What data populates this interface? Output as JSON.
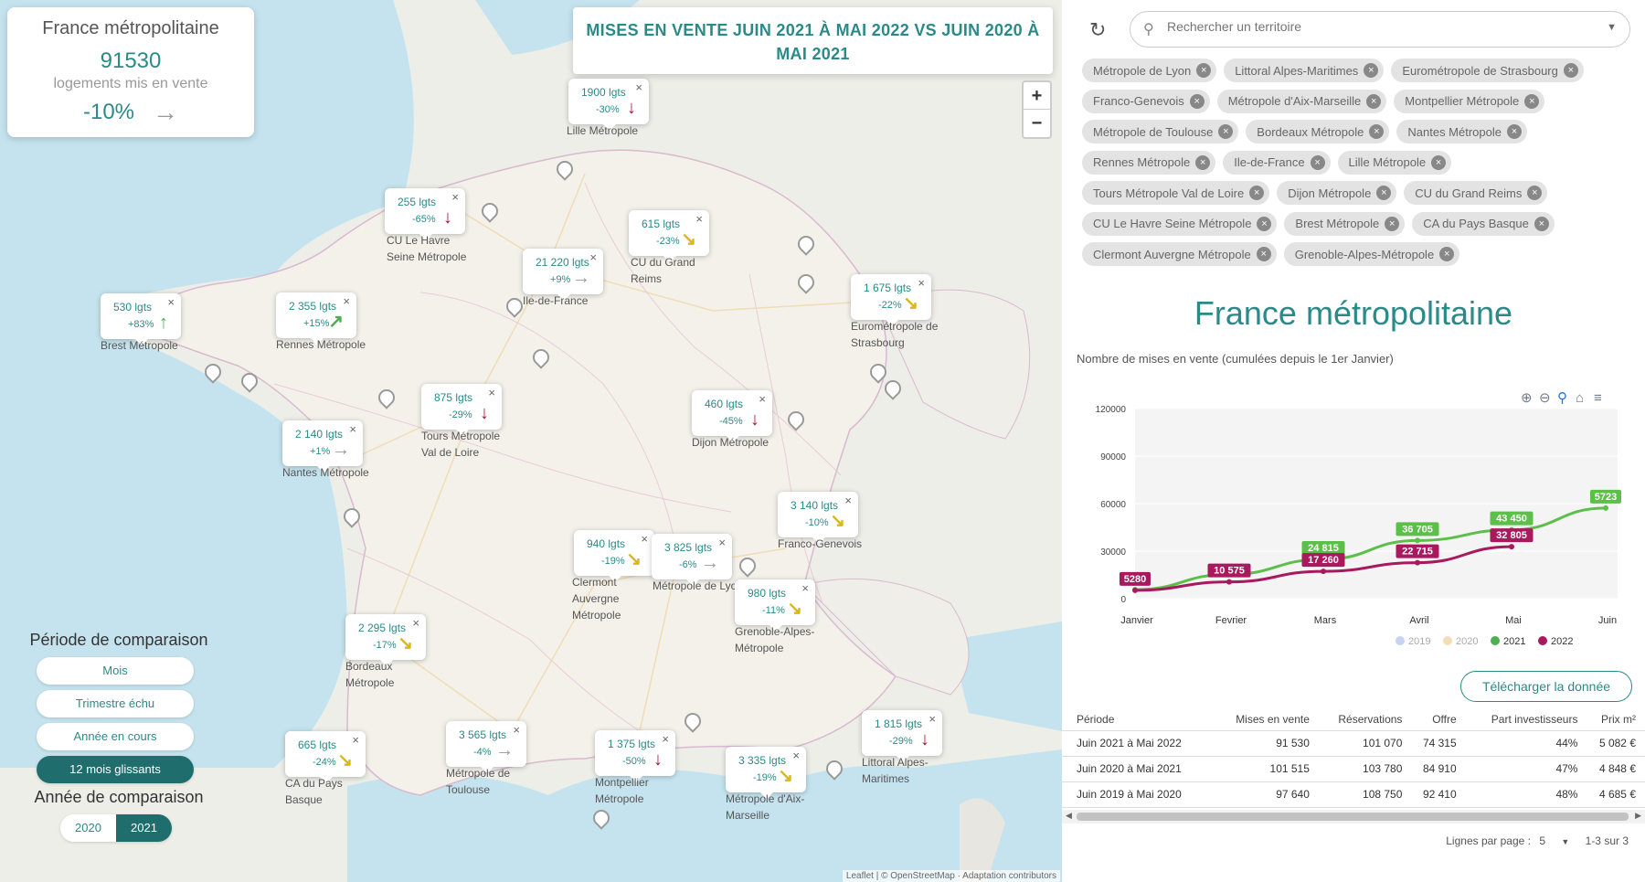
{
  "summary": {
    "title": "France métropolitaine",
    "count": "91530",
    "subtitle": "logements mis en vente",
    "change": "-10%",
    "arrow": "→"
  },
  "map_title": "MISES EN VENTE JUIN 2021 À MAI 2022 VS JUIN 2020 À MAI 2021",
  "zoom": {
    "in": "+",
    "out": "−"
  },
  "markers": [
    {
      "value": "1900 lgts",
      "change": "-30%",
      "trend": "down",
      "label": "Lille Métropole"
    },
    {
      "value": "255 lgts",
      "change": "-65%",
      "trend": "down",
      "label": "CU Le Havre Seine Métropole"
    },
    {
      "value": "615 lgts",
      "change": "-23%",
      "trend": "down-right",
      "label": "CU du Grand Reims"
    },
    {
      "value": "21 220 lgts",
      "change": "+9%",
      "trend": "flat",
      "label": "Ile-de-France"
    },
    {
      "value": "530 lgts",
      "change": "+83%",
      "trend": "up",
      "label": "Brest Métropole"
    },
    {
      "value": "2 355 lgts",
      "change": "+15%",
      "trend": "up-right",
      "label": "Rennes Métropole"
    },
    {
      "value": "1 675 lgts",
      "change": "-22%",
      "trend": "down-right",
      "label": "Eurométropole de Strasbourg"
    },
    {
      "value": "875 lgts",
      "change": "-29%",
      "trend": "down",
      "label": "Tours Métropole Val de Loire"
    },
    {
      "value": "460 lgts",
      "change": "-45%",
      "trend": "down",
      "label": "Dijon Métropole"
    },
    {
      "value": "2 140 lgts",
      "change": "+1%",
      "trend": "flat",
      "label": "Nantes Métropole"
    },
    {
      "value": "3 140 lgts",
      "change": "-10%",
      "trend": "down-right",
      "label": "Franco-Genevois"
    },
    {
      "value": "940 lgts",
      "change": "-19%",
      "trend": "down-right",
      "label": "Clermont Auvergne Métropole"
    },
    {
      "value": "3 825 lgts",
      "change": "-6%",
      "trend": "flat",
      "label": "Métropole de Lyon"
    },
    {
      "value": "980 lgts",
      "change": "-11%",
      "trend": "down-right",
      "label": "Grenoble-Alpes-Métropole"
    },
    {
      "value": "2 295 lgts",
      "change": "-17%",
      "trend": "down-right",
      "label": "Bordeaux Métropole"
    },
    {
      "value": "1 815 lgts",
      "change": "-29%",
      "trend": "down",
      "label": "Littoral Alpes-Maritimes"
    },
    {
      "value": "665 lgts",
      "change": "-24%",
      "trend": "down-right",
      "label": "CA du Pays Basque"
    },
    {
      "value": "3 565 lgts",
      "change": "-4%",
      "trend": "flat",
      "label": "Métropole de Toulouse"
    },
    {
      "value": "1 375 lgts",
      "change": "-50%",
      "trend": "down",
      "label": "Montpellier Métropole"
    },
    {
      "value": "3 335 lgts",
      "change": "-19%",
      "trend": "down-right",
      "label": "Métropole d'Aix-Marseille"
    }
  ],
  "trend_colors": {
    "down": "#a8193c",
    "down-right": "#d8b81a",
    "flat": "#999999",
    "up": "#4caf50",
    "up-right": "#4caf50"
  },
  "period": {
    "title": "Période de comparaison",
    "options": [
      "Mois",
      "Trimestre échu",
      "Année en cours",
      "12 mois glissants"
    ],
    "selected": "12 mois glissants"
  },
  "year": {
    "title": "Année de comparaison",
    "options": [
      "2020",
      "2021"
    ],
    "selected": "2021"
  },
  "attribution": "Leaflet | © OpenStreetMap · Adaptation contributors",
  "search": {
    "placeholder": "Rechercher un territoire"
  },
  "chips": [
    "Métropole de Lyon",
    "Littoral Alpes-Maritimes",
    "Eurométropole de Strasbourg",
    "Franco-Genevois",
    "Métropole d'Aix-Marseille",
    "Montpellier Métropole",
    "Métropole de Toulouse",
    "Bordeaux Métropole",
    "Nantes Métropole",
    "Rennes Métropole",
    "Ile-de-France",
    "Lille Métropole",
    "Tours Métropole Val de Loire",
    "Dijon Métropole",
    "CU du Grand Reims",
    "CU Le Havre Seine Métropole",
    "Brest Métropole",
    "CA du Pays Basque",
    "Clermont Auvergne Métropole",
    "Grenoble-Alpes-Métropole"
  ],
  "panel_title": "France métropolitaine",
  "panel_subtitle": "Nombre de mises en vente (cumulées depuis le 1er Janvier)",
  "chart_data": {
    "type": "line",
    "categories": [
      "Janvier",
      "Fevrier",
      "Mars",
      "Avril",
      "Mai",
      "Juin"
    ],
    "ylim": [
      0,
      120000
    ],
    "yticks": [
      0,
      30000,
      60000,
      90000,
      120000
    ],
    "legend": [
      "2019",
      "2020",
      "2021",
      "2022"
    ],
    "legend_colors": [
      "#c7d3f2",
      "#f5dcb8",
      "#4caf50",
      "#a8195e"
    ],
    "series": [
      {
        "name": "2021",
        "color": "#5cbf4a",
        "values": [
          5700,
          15300,
          24815,
          36705,
          43450,
          57200
        ],
        "labels": [
          "",
          "",
          "24 815",
          "36 705",
          "43 450",
          "5723"
        ]
      },
      {
        "name": "2022",
        "color": "#a8195e",
        "values": [
          5280,
          10575,
          17260,
          22715,
          32805,
          null
        ],
        "labels": [
          "5280",
          "10 575",
          "17 260",
          "22 715",
          "32 805",
          ""
        ]
      }
    ]
  },
  "download_label": "Télécharger la donnée",
  "table": {
    "headers": [
      "Période",
      "Mises en vente",
      "Réservations",
      "Offre",
      "Part investisseurs",
      "Prix m²"
    ],
    "rows": [
      [
        "Juin 2021 à Mai 2022",
        "91 530",
        "101 070",
        "74 315",
        "44%",
        "5 082 €"
      ],
      [
        "Juin 2020 à Mai 2021",
        "101 515",
        "103 780",
        "84 910",
        "47%",
        "4 848 €"
      ],
      [
        "Juin 2019 à Mai 2020",
        "97 640",
        "108 750",
        "92 410",
        "48%",
        "4 685 €"
      ]
    ]
  },
  "pager": {
    "label": "Lignes par page :",
    "size": "5",
    "range": "1-3 sur 3"
  }
}
